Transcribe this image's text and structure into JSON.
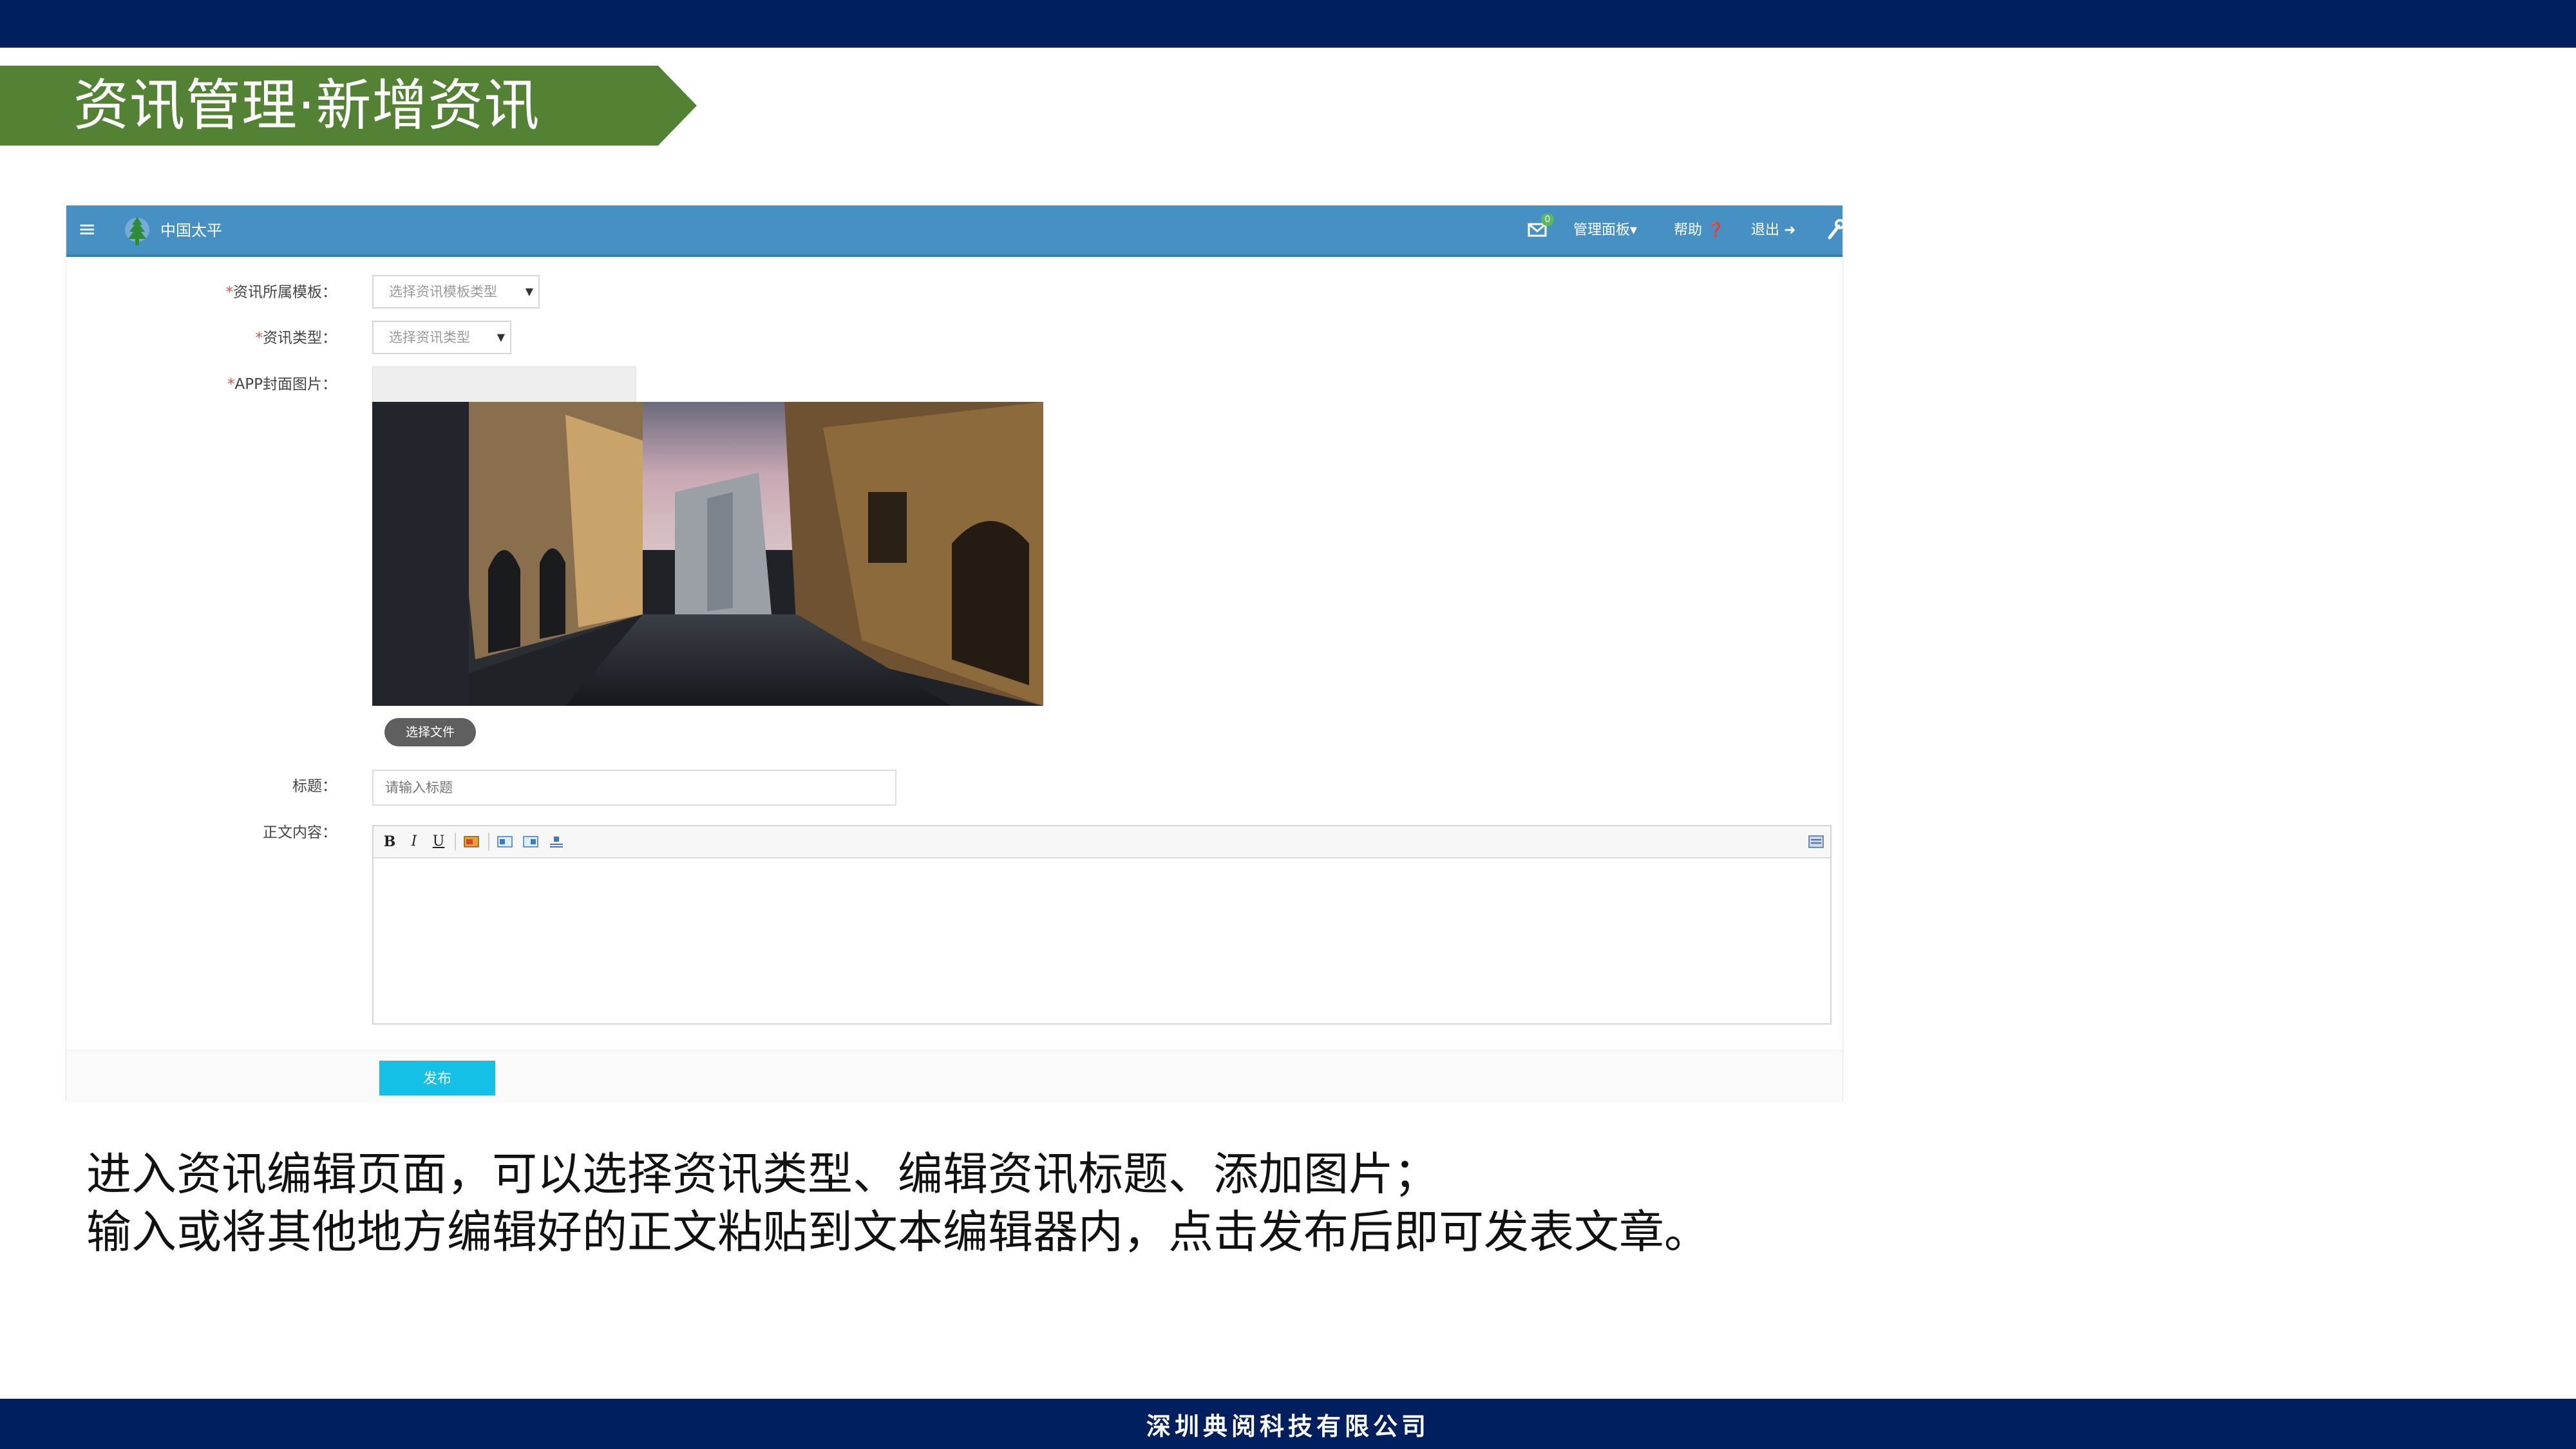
{
  "slide": {
    "title": "资讯管理·新增资讯",
    "description_line1": "进入资讯编辑页面，可以选择资讯类型、编辑资讯标题、添加图片；",
    "description_line2": "输入或将其他地方编辑好的正文粘贴到文本编辑器内，点击发布后即可发表文章。",
    "footer_company": "深圳典阅科技有限公司",
    "colors": {
      "top_bar": "#001f5f",
      "banner": "#538234",
      "app_header": "#4690c4",
      "publish_button": "#15c0e6"
    }
  },
  "app": {
    "header": {
      "menu_icon": "hamburger-icon",
      "logo_icon": "tree-logo-icon",
      "brand": "中国太平",
      "mail_icon": "mail-icon",
      "mail_badge": "0",
      "admin_panel": "管理面板▾",
      "help": "帮助 ❓",
      "logout": "退出 ➜",
      "tool_icon": "wrench-icon"
    },
    "form": {
      "template_label": "资讯所属模板：",
      "template_placeholder": "选择资讯模板类型",
      "type_label": "资讯类型：",
      "type_placeholder": "选择资讯类型",
      "cover_label": "APP封面图片：",
      "cover_image": "street-photo",
      "choose_file": "选择文件",
      "title_label": "标题：",
      "title_placeholder": "请输入标题",
      "content_label": "正文内容：",
      "toolbar": {
        "bold": "B",
        "italic": "I",
        "underline": "U"
      },
      "publish": "发布"
    }
  }
}
